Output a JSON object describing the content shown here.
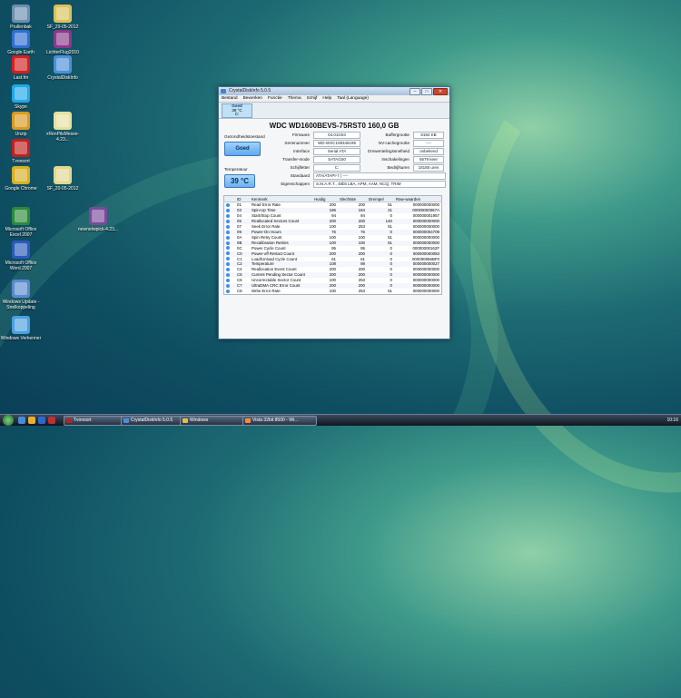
{
  "desktop": {
    "icons": [
      {
        "label": "Prullenbak",
        "color": "#6b8fb0"
      },
      {
        "label": "SF_29-05-2012",
        "color": "#d9c25a"
      },
      {
        "label": "Google Earth",
        "color": "#2f6fd0"
      },
      {
        "label": "LichterFlug2010",
        "color": "#8a3a8a"
      },
      {
        "label": "Last.fm",
        "color": "#d22020"
      },
      {
        "label": "CrystalDiskInfo",
        "color": "#4a90d9"
      },
      {
        "label": "Skype",
        "color": "#1fa8e8"
      },
      {
        "label": "Unzip",
        "color": "#d99a20"
      },
      {
        "label": "xRenPilsMesse-4.23...",
        "color": "#e8e0a0"
      },
      {
        "label": "Tvonsort",
        "color": "#c02020"
      },
      {
        "label": "Google Chrome",
        "color": "#d8b020"
      },
      {
        "label": "SF_20-05-2012",
        "color": "#e0d890"
      },
      {
        "label": "Microsoft Office Excel 2007",
        "color": "#2a8a3a"
      },
      {
        "label": "newnetwpick-4.23...",
        "color": "#7a4a9a"
      },
      {
        "label": "Microsoft Office Word 2007",
        "color": "#2a5aba"
      },
      {
        "label": "Windows Update - Snelkoppeling",
        "color": "#5a8ad0"
      },
      {
        "label": "Windows Verkenner",
        "color": "#4aa0e0"
      }
    ]
  },
  "window": {
    "title": "CrystalDiskInfo 5.0.5",
    "menu": [
      "Bestand",
      "Bewerken",
      "Functie",
      "Thema",
      "Schijf",
      "Help",
      "Taal (Language)"
    ],
    "drive_tab": {
      "status": "Goed",
      "temp": "39 °C",
      "letter": "C:"
    },
    "model": "WDC WD1600BEVS-75RST0  160,0 GB",
    "labels": {
      "health": "Gezondheidstoestand",
      "temperature": "Temperatuur",
      "firmware": "Firmware",
      "serial": "Serienummer",
      "interface": "Interface",
      "transfer": "Transfer-mode",
      "drive_letter": "Schijfletter",
      "standard": "Standaard",
      "features": "Eigenschappen",
      "buffer": "Buffergrootte",
      "nvcache": "NV-cachegrootte",
      "rotation": "Omwentelingssnelheid",
      "power_on_count": "Inschakelingen",
      "power_on_hours": "Bedrijfsuren"
    },
    "values": {
      "health": "Goed",
      "temperature": "39 °C",
      "firmware": "04.01G04",
      "serial": "WD-WXC108346195",
      "interface": "Serial ATA",
      "transfer": "SATA/150",
      "drive_letter": "C:",
      "standard": "ATA/ATAPI-7 | ----",
      "features": "S.M.A.R.T., 48bit LBA, APM, AAM, NCQ, TRIM",
      "buffer": "8192 KB",
      "nvcache": "----",
      "rotation": "onbekend",
      "power_on_count": "5679 keer",
      "power_on_hours": "18185 uren"
    },
    "smart": {
      "headers": [
        "",
        "ID",
        "Kenmerk",
        "Huidig",
        "Slechtste",
        "Drempel",
        "Raw-waarden"
      ],
      "rows": [
        [
          "01",
          "Read Error Rate",
          "200",
          "200",
          "51",
          "000000000000"
        ],
        [
          "03",
          "Spin-Up Time",
          "186",
          "184",
          "21",
          "00000000067A"
        ],
        [
          "04",
          "Start/Stop Count",
          "94",
          "94",
          "0",
          "000000001957"
        ],
        [
          "05",
          "Reallocated Sectors Count",
          "200",
          "200",
          "140",
          "000000000000"
        ],
        [
          "07",
          "Seek Error Rate",
          "100",
          "253",
          "51",
          "000000000000"
        ],
        [
          "09",
          "Power-On Hours",
          "76",
          "76",
          "0",
          "000000004709"
        ],
        [
          "0A",
          "Spin Retry Count",
          "100",
          "100",
          "51",
          "000000000000"
        ],
        [
          "0B",
          "Recalibration Retries",
          "100",
          "100",
          "51",
          "000000000000"
        ],
        [
          "0C",
          "Power Cycle Count",
          "95",
          "95",
          "0",
          "00000000162F"
        ],
        [
          "C0",
          "Power-off Retract Count",
          "200",
          "200",
          "0",
          "000000000083"
        ],
        [
          "C1",
          "Load/Unload Cycle Count",
          "61",
          "61",
          "0",
          "000000066BF0"
        ],
        [
          "C2",
          "Temperature",
          "108",
          "98",
          "0",
          "000000000027"
        ],
        [
          "C4",
          "Reallocation Event Count",
          "200",
          "200",
          "0",
          "000000000000"
        ],
        [
          "C5",
          "Current Pending Sector Count",
          "200",
          "200",
          "0",
          "000000000000"
        ],
        [
          "C6",
          "Uncorrectable Sector Count",
          "100",
          "253",
          "0",
          "000000000000"
        ],
        [
          "C7",
          "UltraDMA CRC Error Count",
          "200",
          "200",
          "0",
          "000000000000"
        ],
        [
          "C8",
          "Write Error Rate",
          "100",
          "253",
          "51",
          "000000000000"
        ]
      ]
    }
  },
  "taskbar": {
    "buttons": [
      {
        "label": "Tvonsort",
        "color": "#c02020"
      },
      {
        "label": "CrystalDiskInfo 5.0.5",
        "color": "#4a90d9"
      },
      {
        "label": "Windows",
        "color": "#e0c040"
      },
      {
        "label": "Vista 32bit 8500 - Wi...",
        "color": "#ff8a30"
      }
    ],
    "clock": "10:16"
  }
}
